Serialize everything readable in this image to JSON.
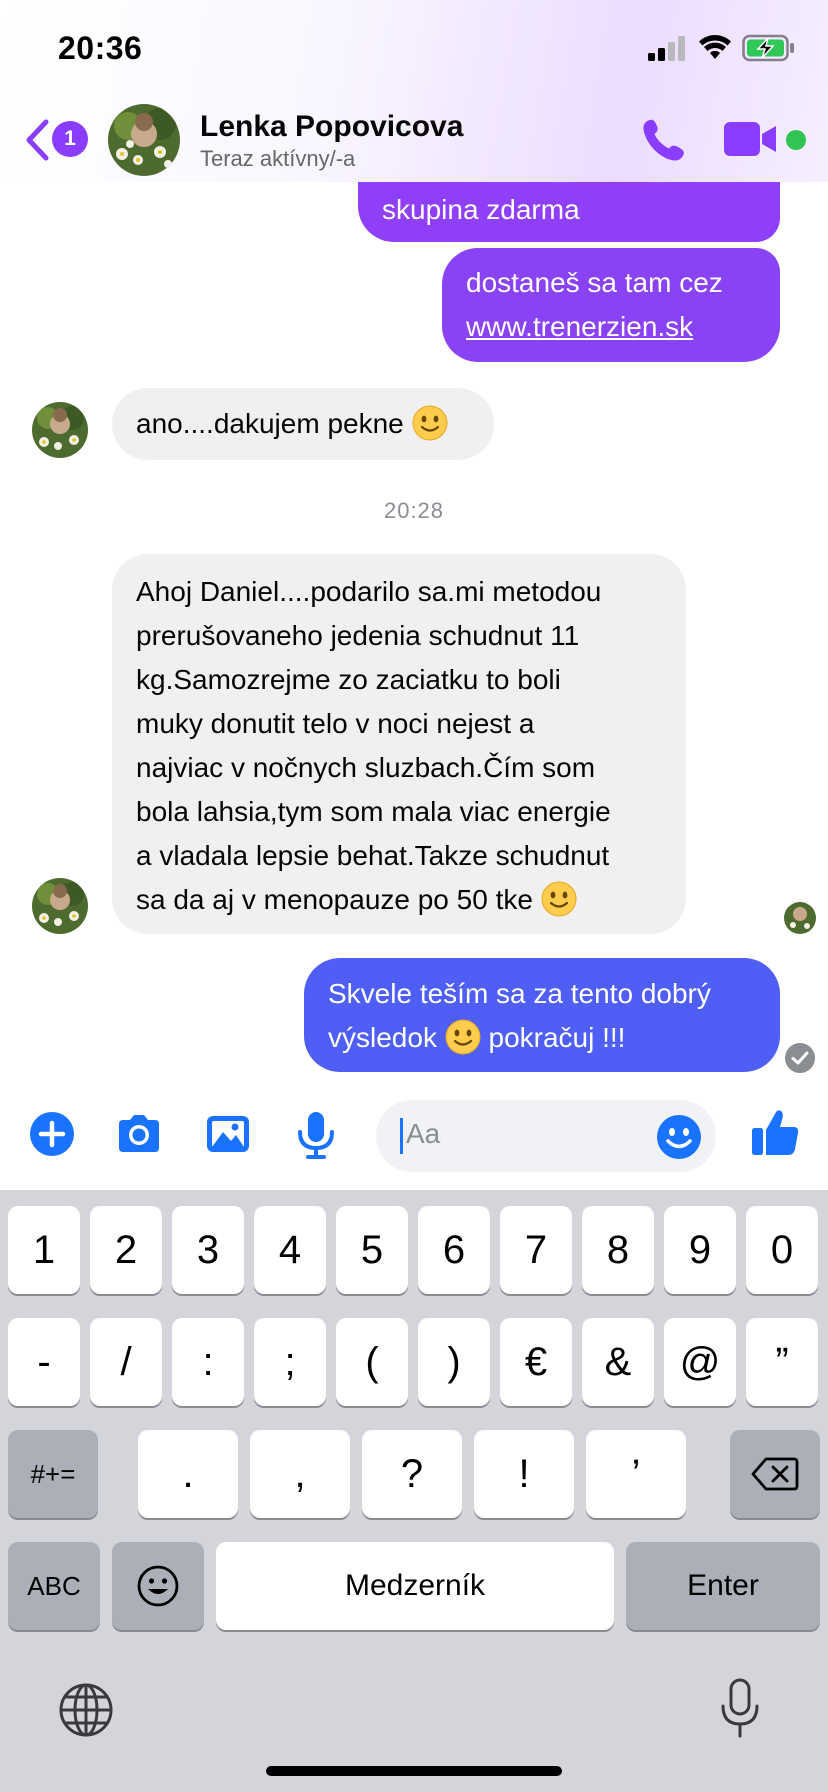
{
  "status_bar": {
    "time": "20:36"
  },
  "header": {
    "back_badge": "1",
    "contact_name": "Lenka Popovicova",
    "contact_status": "Teraz aktívny/-a"
  },
  "messages": {
    "out1_text": "skupina zdarma",
    "out2_line1": "dostaneš sa tam cez",
    "out2_link": "www.trenerzien.sk",
    "in1_text": "ano....dakujem pekne",
    "timestamp": "20:28",
    "in2_lines": [
      "Ahoj Daniel....podarilo sa.mi metodou",
      "prerušovaneho jedenia schudnut 11",
      "kg.Samozrejme zo zaciatku to boli",
      "muky donutit telo v noci nejest a",
      "najviac v nočnych sluzbach.Čím som",
      "bola lahsia,tym som mala viac energie",
      "a vladala lepsie behat.Takze schudnut",
      "sa da aj v menopauze po 50 tke"
    ],
    "out3_line1": "Skvele teším sa za tento dobrý",
    "out3_line2a": "výsledok",
    "out3_line2b": "pokračuj !!!"
  },
  "composer": {
    "placeholder": "Aa"
  },
  "keyboard": {
    "row1": [
      "1",
      "2",
      "3",
      "4",
      "5",
      "6",
      "7",
      "8",
      "9",
      "0"
    ],
    "row2": [
      "-",
      "/",
      ":",
      ";",
      "(",
      ")",
      "€",
      "&",
      "@",
      "”"
    ],
    "row3": {
      "shift": "#+=",
      "keys": [
        ".",
        ",",
        "?",
        "!",
        "’"
      ]
    },
    "row4": {
      "abc": "ABC",
      "space": "Medzerník",
      "enter": "Enter"
    }
  },
  "colors": {
    "accent": "#8b3dff",
    "bubble_purple": "#8e3ff7",
    "bubble_blue": "#4f5ff5",
    "incoming_bg": "#f0f0f0",
    "composer_blue": "#1a73ff"
  }
}
